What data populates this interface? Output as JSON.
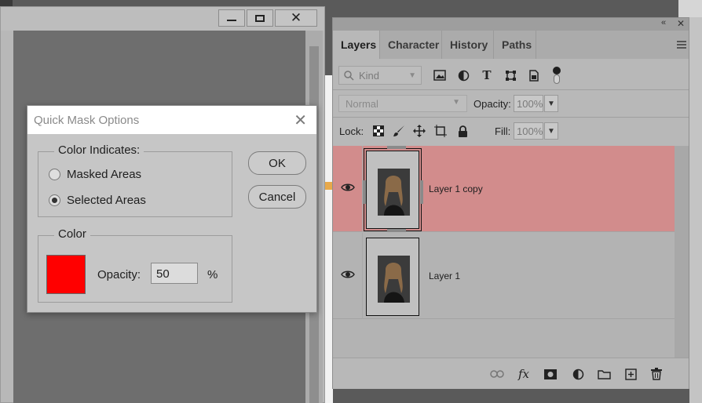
{
  "background_window": {
    "controls": [
      "minimize",
      "maximize",
      "close"
    ]
  },
  "quick_mask_dialog": {
    "title": "Quick Mask Options",
    "color_indicates_legend": "Color Indicates:",
    "options": [
      {
        "label": "Masked Areas",
        "selected": false
      },
      {
        "label": "Selected Areas",
        "selected": true
      }
    ],
    "color_legend": "Color",
    "swatch_color": "#ff0000",
    "opacity_label": "Opacity:",
    "opacity_value": "50",
    "percent_sign": "%",
    "ok_label": "OK",
    "cancel_label": "Cancel"
  },
  "layers_panel": {
    "tabs": [
      "Layers",
      "Character",
      "History",
      "Paths"
    ],
    "active_tab": "Layers",
    "filter": {
      "kind_label": "Kind",
      "icons": [
        "image-filter-icon",
        "adjustment-filter-icon",
        "type-filter-icon",
        "shape-filter-icon",
        "smart-object-filter-icon"
      ]
    },
    "blend_mode": "Normal",
    "opacity_label": "Opacity:",
    "opacity_value": "100%",
    "lock_label": "Lock:",
    "fill_label": "Fill:",
    "fill_value": "100%",
    "layers": [
      {
        "name": "Layer 1 copy",
        "visible": true,
        "selected": true
      },
      {
        "name": "Layer 1",
        "visible": true,
        "selected": false
      }
    ],
    "selected_color": "#d28c8c",
    "bottom_icons": [
      "link-layers-icon",
      "fx-icon",
      "add-mask-icon",
      "adjustment-layer-icon",
      "group-folder-icon",
      "new-layer-icon",
      "delete-layer-icon"
    ]
  }
}
